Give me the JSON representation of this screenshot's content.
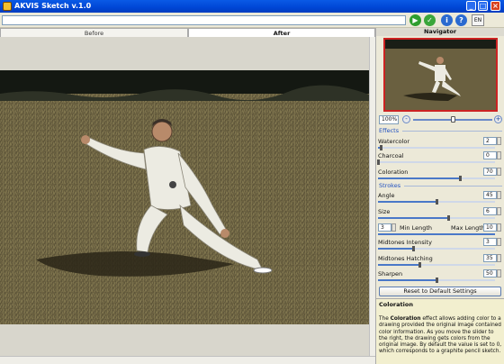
{
  "window": {
    "title": "AKVIS Sketch v.1.0"
  },
  "toolbar": {
    "path_value": "",
    "language": "EN"
  },
  "tabs": {
    "before": "Before",
    "after": "After"
  },
  "navigator": {
    "title": "Navigator",
    "zoom": "100%",
    "zoom_minus": "-",
    "zoom_plus": "+"
  },
  "effects": {
    "title": "Effects",
    "watercolor": {
      "label": "Watercolor",
      "value": "2",
      "fraction": 0.02
    },
    "charcoal": {
      "label": "Charcoal",
      "value": "0",
      "fraction": 0.0
    },
    "coloration": {
      "label": "Coloration",
      "value": "70",
      "fraction": 0.7
    }
  },
  "strokes": {
    "title": "Strokes",
    "angle": {
      "label": "Angle",
      "value": "45",
      "fraction": 0.5
    },
    "size": {
      "label": "Size",
      "value": "6",
      "fraction": 0.6
    },
    "min_length": {
      "label": "Min Length",
      "value": "3"
    },
    "max_length": {
      "label": "Max Length",
      "value": "10"
    },
    "midtones_intensity": {
      "label": "Midtones Intensity",
      "value": "3",
      "fraction": 0.3
    },
    "midtones_hatching": {
      "label": "Midtones Hatching",
      "value": "35",
      "fraction": 0.35
    },
    "sharpen": {
      "label": "Sharpen",
      "value": "50",
      "fraction": 0.5
    }
  },
  "reset_label": "Reset to Default Settings",
  "help": {
    "title": "Coloration",
    "pre": "The ",
    "term": "Coloration",
    "body": " effect allows adding color to a drawing provided the original image contained color information. As you move the slider to the right, the drawing gets colors from the original image. By default the value is set to 0, which corresponds to a graphite pencil sketch."
  },
  "colors": {
    "accent": "#2050c0",
    "titlebar": "#0046d5",
    "nav_border": "#cc2222"
  }
}
